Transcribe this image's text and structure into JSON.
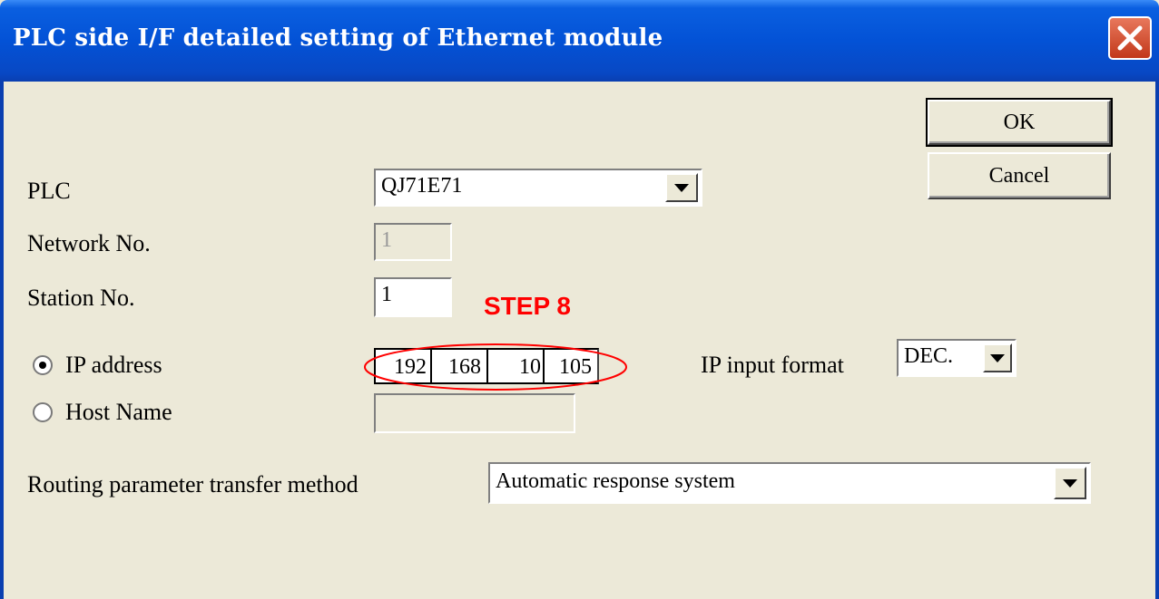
{
  "window": {
    "title": "PLC side I/F detailed setting of Ethernet module"
  },
  "buttons": {
    "ok": "OK",
    "cancel": "Cancel"
  },
  "fields": {
    "plc": {
      "label": "PLC",
      "value": "QJ71E71"
    },
    "network_no": {
      "label": "Network No.",
      "value": "1"
    },
    "station_no": {
      "label": "Station No.",
      "value": "1"
    },
    "ip_address": {
      "label": "IP address",
      "octets": [
        "192",
        "168",
        "10",
        "105"
      ],
      "selected": true
    },
    "host_name": {
      "label": "Host Name",
      "value": "",
      "selected": false
    },
    "ip_input_format": {
      "label": "IP input format",
      "value": "DEC."
    },
    "routing": {
      "label": "Routing parameter transfer method",
      "value": "Automatic response system"
    }
  },
  "annotation": {
    "step": "STEP 8",
    "color": "#ff0000"
  },
  "colors": {
    "titlebar": "#0352d6",
    "dialog_bg": "#ece9d8"
  }
}
